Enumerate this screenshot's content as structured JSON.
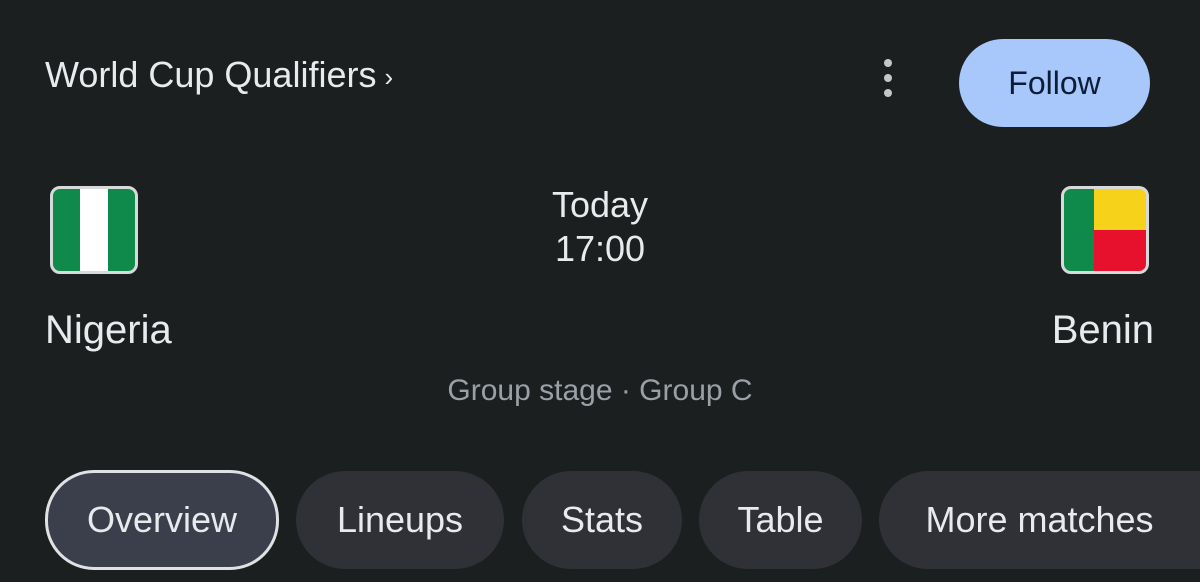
{
  "header": {
    "title": "World Cup Qualifiers",
    "title_chevron": "›",
    "more_icon": "more-vert-icon",
    "follow_label": "Follow"
  },
  "match": {
    "home": {
      "name": "Nigeria",
      "flag": {
        "icon": "nigeria-flag-icon",
        "colors": [
          "#0f8a4b",
          "#ffffff",
          "#0f8a4b"
        ]
      }
    },
    "away": {
      "name": "Benin",
      "flag": {
        "icon": "benin-flag-icon",
        "colors": [
          "#0f8a4b",
          "#f6d21b",
          "#e8112d"
        ]
      }
    },
    "day": "Today",
    "time": "17:00",
    "stage": "Group stage · Group C"
  },
  "tabs": [
    {
      "label": "Overview",
      "active": true
    },
    {
      "label": "Lineups",
      "active": false
    },
    {
      "label": "Stats",
      "active": false
    },
    {
      "label": "Table",
      "active": false
    },
    {
      "label": "More matches",
      "active": false
    }
  ],
  "colors": {
    "background": "#1c1f20",
    "follow_button": "#a8c7fa",
    "tab_background": "#2f3136",
    "tab_active_background": "#3a3f4b",
    "muted_text": "#9aa0a6"
  }
}
